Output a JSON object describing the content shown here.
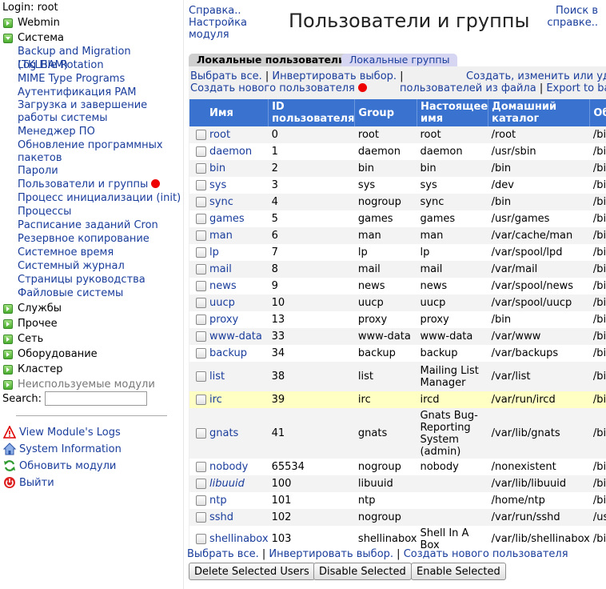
{
  "sidebar": {
    "login": "Login: root",
    "categories": {
      "webmin": "Webmin",
      "system": "Система",
      "services": "Службы",
      "other": "Прочее",
      "network": "Сеть",
      "hardware": "Оборудование",
      "cluster": "Кластер",
      "unused": "Неиспользуемые модули"
    },
    "modules": [
      "Backup and Migration (TKLBAM)",
      "Log File Rotation",
      "MIME Type Programs",
      "Аутентификация PAM",
      "Загрузка и завершение работы системы",
      "Менеджер ПО",
      "Обновление программных пакетов",
      "Пароли",
      "Пользователи и группы",
      "Процесс инициализации (init)",
      "Процессы",
      "Расписание заданий Cron",
      "Резервное копирование",
      "Системное время",
      "Системный журнал",
      "Страницы руководства",
      "Файловые системы"
    ],
    "search_label": "Search:",
    "search_value": "",
    "utils": {
      "logs": "View Module's Logs",
      "sysinfo": "System Information",
      "refresh": "Обновить модули",
      "logout": "Выйти"
    }
  },
  "header": {
    "help": "Справка..",
    "config1": "Настройка",
    "config2": "модуля",
    "title": "Пользователи и группы",
    "search_help1": "Поиск в",
    "search_help2": "справке.."
  },
  "tabs": {
    "users": "Локальные пользователи",
    "groups": "Локальные группы"
  },
  "actions": {
    "select_all": "Выбрать все.",
    "invert": "Инвертировать выбор.",
    "create_user": "Создать нового пользователя",
    "batch1": "Создать, изменить или удал",
    "batch2": "пользователей из файла",
    "export": "Export to batch f"
  },
  "table": {
    "headers": {
      "name": "Имя",
      "id1": "ID",
      "id2": "пользователя",
      "group": "Group",
      "real1": "Настоящее",
      "real2": "имя",
      "home1": "Домашний",
      "home2": "каталог",
      "shell": "Оболочка"
    },
    "rows": [
      {
        "name": "root",
        "id": "0",
        "group": "root",
        "real": "root",
        "home": "/root",
        "shell": "/bin/bash"
      },
      {
        "name": "daemon",
        "id": "1",
        "group": "daemon",
        "real": "daemon",
        "home": "/usr/sbin",
        "shell": "/bin/sh"
      },
      {
        "name": "bin",
        "id": "2",
        "group": "bin",
        "real": "bin",
        "home": "/bin",
        "shell": "/bin/sh"
      },
      {
        "name": "sys",
        "id": "3",
        "group": "sys",
        "real": "sys",
        "home": "/dev",
        "shell": "/bin/sh"
      },
      {
        "name": "sync",
        "id": "4",
        "group": "nogroup",
        "real": "sync",
        "home": "/bin",
        "shell": "/bin/sync"
      },
      {
        "name": "games",
        "id": "5",
        "group": "games",
        "real": "games",
        "home": "/usr/games",
        "shell": "/bin/sh"
      },
      {
        "name": "man",
        "id": "6",
        "group": "man",
        "real": "man",
        "home": "/var/cache/man",
        "shell": "/bin/sh"
      },
      {
        "name": "lp",
        "id": "7",
        "group": "lp",
        "real": "lp",
        "home": "/var/spool/lpd",
        "shell": "/bin/sh"
      },
      {
        "name": "mail",
        "id": "8",
        "group": "mail",
        "real": "mail",
        "home": "/var/mail",
        "shell": "/bin/sh"
      },
      {
        "name": "news",
        "id": "9",
        "group": "news",
        "real": "news",
        "home": "/var/spool/news",
        "shell": "/bin/sh"
      },
      {
        "name": "uucp",
        "id": "10",
        "group": "uucp",
        "real": "uucp",
        "home": "/var/spool/uucp",
        "shell": "/bin/sh"
      },
      {
        "name": "proxy",
        "id": "13",
        "group": "proxy",
        "real": "proxy",
        "home": "/bin",
        "shell": "/bin/sh"
      },
      {
        "name": "www-data",
        "id": "33",
        "group": "www-data",
        "real": "www-data",
        "home": "/var/www",
        "shell": "/bin/sh"
      },
      {
        "name": "backup",
        "id": "34",
        "group": "backup",
        "real": "backup",
        "home": "/var/backups",
        "shell": "/bin/sh"
      },
      {
        "name": "list",
        "id": "38",
        "group": "list",
        "real": "Mailing List Manager",
        "home": "/var/list",
        "shell": "/bin/sh"
      },
      {
        "name": "irc",
        "id": "39",
        "group": "irc",
        "real": "ircd",
        "home": "/var/run/ircd",
        "shell": "/bin/sh",
        "highlight": true
      },
      {
        "name": "gnats",
        "id": "41",
        "group": "gnats",
        "real": "Gnats Bug-Reporting System (admin)",
        "home": "/var/lib/gnats",
        "shell": "/bin/sh"
      },
      {
        "name": "nobody",
        "id": "65534",
        "group": "nogroup",
        "real": "nobody",
        "home": "/nonexistent",
        "shell": "/bin/sh"
      },
      {
        "name": "libuuid",
        "id": "100",
        "group": "libuuid",
        "real": "",
        "home": "/var/lib/libuuid",
        "shell": "/bin/sh",
        "italic": true
      },
      {
        "name": "ntp",
        "id": "101",
        "group": "ntp",
        "real": "",
        "home": "/home/ntp",
        "shell": "/bin/false"
      },
      {
        "name": "sshd",
        "id": "102",
        "group": "nogroup",
        "real": "",
        "home": "/var/run/sshd",
        "shell": "/usr/sbin/nolo"
      },
      {
        "name": "shellinabox",
        "id": "103",
        "group": "shellinabox",
        "real": "Shell In A Box",
        "home": "/var/lib/shellinabox",
        "shell": "/bin/false"
      }
    ]
  },
  "buttons": {
    "delete": "Delete Selected Users",
    "disable": "Disable Selected",
    "enable": "Enable Selected"
  },
  "colors": {
    "header_bg": "#3a73cf",
    "link": "#1a3d9c",
    "highlight_row": "#ffffc4",
    "active_indicator": "#ee0000"
  }
}
